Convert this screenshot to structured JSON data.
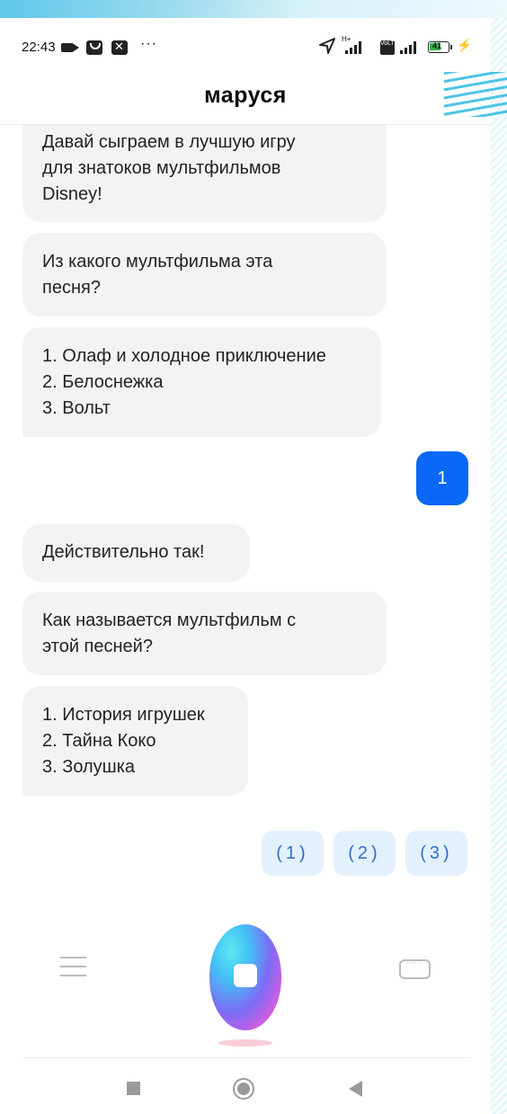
{
  "status_bar": {
    "time": "22:43",
    "more": "···",
    "network_label": "H+",
    "lte_label": "VoLTE",
    "battery_level": "41"
  },
  "app": {
    "title": "маруся"
  },
  "messages": [
    {
      "from": "assistant",
      "text": "Давай сыграем в лучшую игру\nдля знатоков мультфильмов\nDisney!"
    },
    {
      "from": "assistant",
      "text": "Из какого мультфильма эта\nпесня?"
    },
    {
      "from": "assistant",
      "text": "1. Олаф и холодное приключение\n2. Белоснежка\n3. Вольт"
    },
    {
      "from": "user",
      "text": "1"
    },
    {
      "from": "assistant",
      "text": "Действительно так!"
    },
    {
      "from": "assistant",
      "text": "Как называется мультфильм с\nэтой песней?"
    },
    {
      "from": "assistant",
      "text": "1. История игрушек\n2. Тайна Коко\n3. Золушка"
    }
  ],
  "quick_replies": [
    "(1)",
    "(2)",
    "(3)"
  ],
  "colors": {
    "user_bubble": "#0a68f8",
    "assistant_bubble": "#f2f3f5",
    "chip_bg": "#e3f0fe",
    "chip_text": "#2f6fc6"
  },
  "icons": {
    "menu": "hamburger-icon",
    "voice": "marusya-voice-orb",
    "keyboard": "keyboard-icon",
    "nav_recent": "square-icon",
    "nav_home": "circle-icon",
    "nav_back": "triangle-back-icon"
  }
}
